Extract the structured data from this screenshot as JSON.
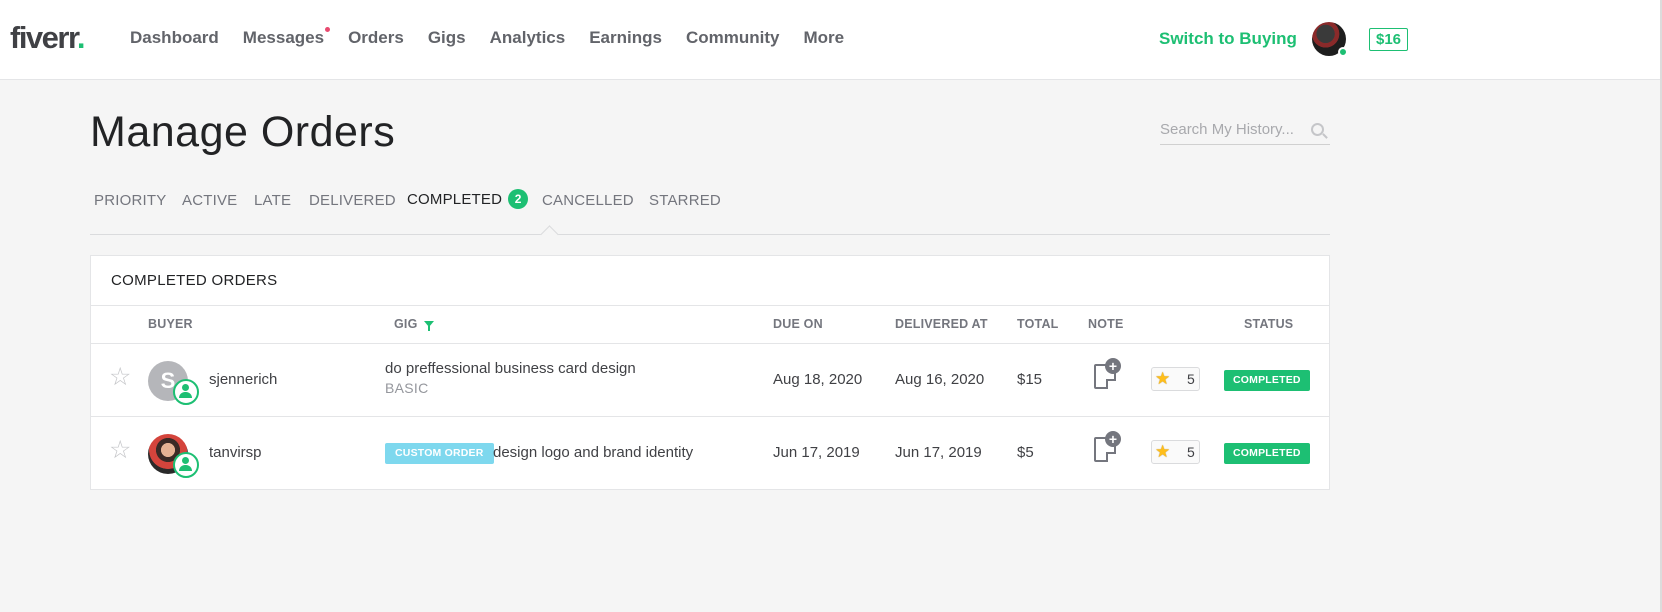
{
  "header": {
    "logo_text": "fiverr",
    "logo_dot": ".",
    "nav": [
      {
        "label": "Dashboard"
      },
      {
        "label": "Messages"
      },
      {
        "label": "Orders"
      },
      {
        "label": "Gigs"
      },
      {
        "label": "Analytics"
      },
      {
        "label": "Earnings"
      },
      {
        "label": "Community"
      },
      {
        "label": "More"
      }
    ],
    "switch_label": "Switch to Buying",
    "balance": "$16"
  },
  "page": {
    "title": "Manage Orders",
    "search_placeholder": "Search My History..."
  },
  "tabs": [
    {
      "label": "PRIORITY"
    },
    {
      "label": "ACTIVE"
    },
    {
      "label": "LATE"
    },
    {
      "label": "DELIVERED"
    },
    {
      "label": "COMPLETED",
      "count": "2",
      "active": true
    },
    {
      "label": "CANCELLED"
    },
    {
      "label": "STARRED"
    }
  ],
  "table": {
    "title": "COMPLETED ORDERS",
    "columns": {
      "buyer": "BUYER",
      "gig": "GIG",
      "due_on": "DUE ON",
      "delivered_at": "DELIVERED AT",
      "total": "TOTAL",
      "note": "NOTE",
      "status": "STATUS"
    },
    "rows": [
      {
        "avatar_letter": "S",
        "buyer": "sjennerich",
        "gig": "do preffessional business card design",
        "package": "BASIC",
        "badge": "",
        "due_on": "Aug 18, 2020",
        "delivered_at": "Aug 16, 2020",
        "total": "$15",
        "note_plus": "+",
        "rating": "5",
        "status": "COMPLETED"
      },
      {
        "avatar_letter": "",
        "buyer": "tanvirsp",
        "gig": "design logo and brand identity",
        "package": "",
        "badge": "CUSTOM ORDER",
        "due_on": "Jun 17, 2019",
        "delivered_at": "Jun 17, 2019",
        "total": "$5",
        "note_plus": "+",
        "rating": "5",
        "status": "COMPLETED"
      }
    ]
  },
  "icons": {
    "star_empty": "☆",
    "star_filled": "★"
  },
  "colors": {
    "brand_green": "#1dbf73",
    "custom_badge": "#7ed8ee",
    "notification_dot": "#e84a6f",
    "rating_star": "#ffbe1a"
  }
}
